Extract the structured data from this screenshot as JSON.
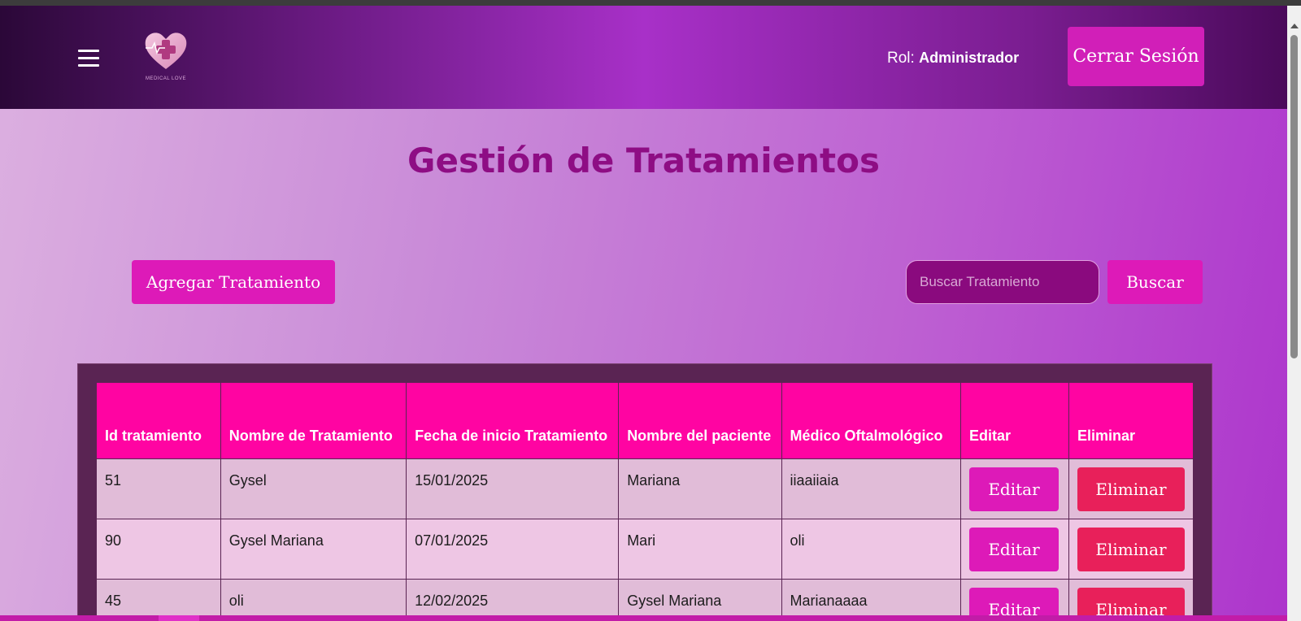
{
  "header": {
    "logo_text": "MEDICAL LOVE",
    "rol_label": "Rol:",
    "rol_value": "Administrador",
    "logout_label": "Cerrar Sesión"
  },
  "page_title": "Gestión de Tratamientos",
  "toolbar": {
    "add_label": "Agregar Tratamiento",
    "search_placeholder": "Buscar Tratamiento",
    "search_label": "Buscar"
  },
  "table": {
    "headers": {
      "id": "Id tratamiento",
      "nombre": "Nombre de Tratamiento",
      "fecha": "Fecha de inicio Tratamiento",
      "paciente": "Nombre del paciente",
      "medico": "Médico Oftalmológico",
      "editar": "Editar",
      "eliminar": "Eliminar"
    },
    "rows": [
      {
        "id": "51",
        "nombre": "Gysel",
        "fecha": "15/01/2025",
        "paciente": "Mariana",
        "medico": "iiaaiiaia",
        "edit": "Editar",
        "delete": "Eliminar"
      },
      {
        "id": "90",
        "nombre": "Gysel Mariana",
        "fecha": "07/01/2025",
        "paciente": "Mari",
        "medico": "oli",
        "edit": "Editar",
        "delete": "Eliminar"
      },
      {
        "id": "45",
        "nombre": "oli",
        "fecha": "12/02/2025",
        "paciente": "Gysel Mariana",
        "medico": "Marianaaaa",
        "edit": "Editar",
        "delete": "Eliminar"
      }
    ]
  },
  "colors": {
    "accent": "#dd1ab8",
    "header_row": "#ff04a2",
    "delete": "#e8205a",
    "title": "#8e0d84"
  }
}
